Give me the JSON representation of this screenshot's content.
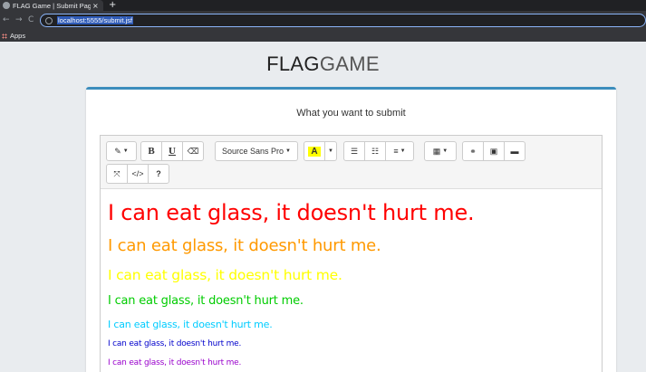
{
  "browser": {
    "tab_title": "FLAG Game | Submit Page",
    "tab_close": "×",
    "new_tab": "+",
    "back": "←",
    "forward": "→",
    "reload": "C",
    "url": "localhost:5555/submit.jsf",
    "bookmarks_apps": "Apps"
  },
  "page": {
    "brand_bold": "FLAG",
    "brand_light": "GAME",
    "card_title": "What you want to submit"
  },
  "toolbar": {
    "magic": "✎",
    "bold": "B",
    "underline": "U",
    "eraser": "⌫",
    "font_name": "Source Sans Pro",
    "color_letter": "A",
    "ul": "☰",
    "ol": "☷",
    "align": "≡",
    "table": "▦",
    "link": "⚭",
    "picture": "▣",
    "video": "▬",
    "fullscreen": "⤧",
    "codeview": "</>",
    "help": "?"
  },
  "content": {
    "lines": [
      {
        "text": "I can eat glass, it doesn't hurt me.",
        "color": "#ff0000"
      },
      {
        "text": "I can eat glass, it doesn't hurt me.",
        "color": "#ff9900"
      },
      {
        "text": "I can eat glass, it doesn't hurt me.",
        "color": "#ffff00"
      },
      {
        "text": "I can eat glass, it doesn't hurt me.",
        "color": "#00cc00"
      },
      {
        "text": "I can eat glass, it doesn't hurt me.",
        "color": "#00ccff"
      },
      {
        "text": "I can eat glass, it doesn't hurt me.",
        "color": "#0000cc"
      },
      {
        "text": "I can eat glass, it doesn't hurt me.",
        "color": "#9900cc"
      }
    ]
  }
}
